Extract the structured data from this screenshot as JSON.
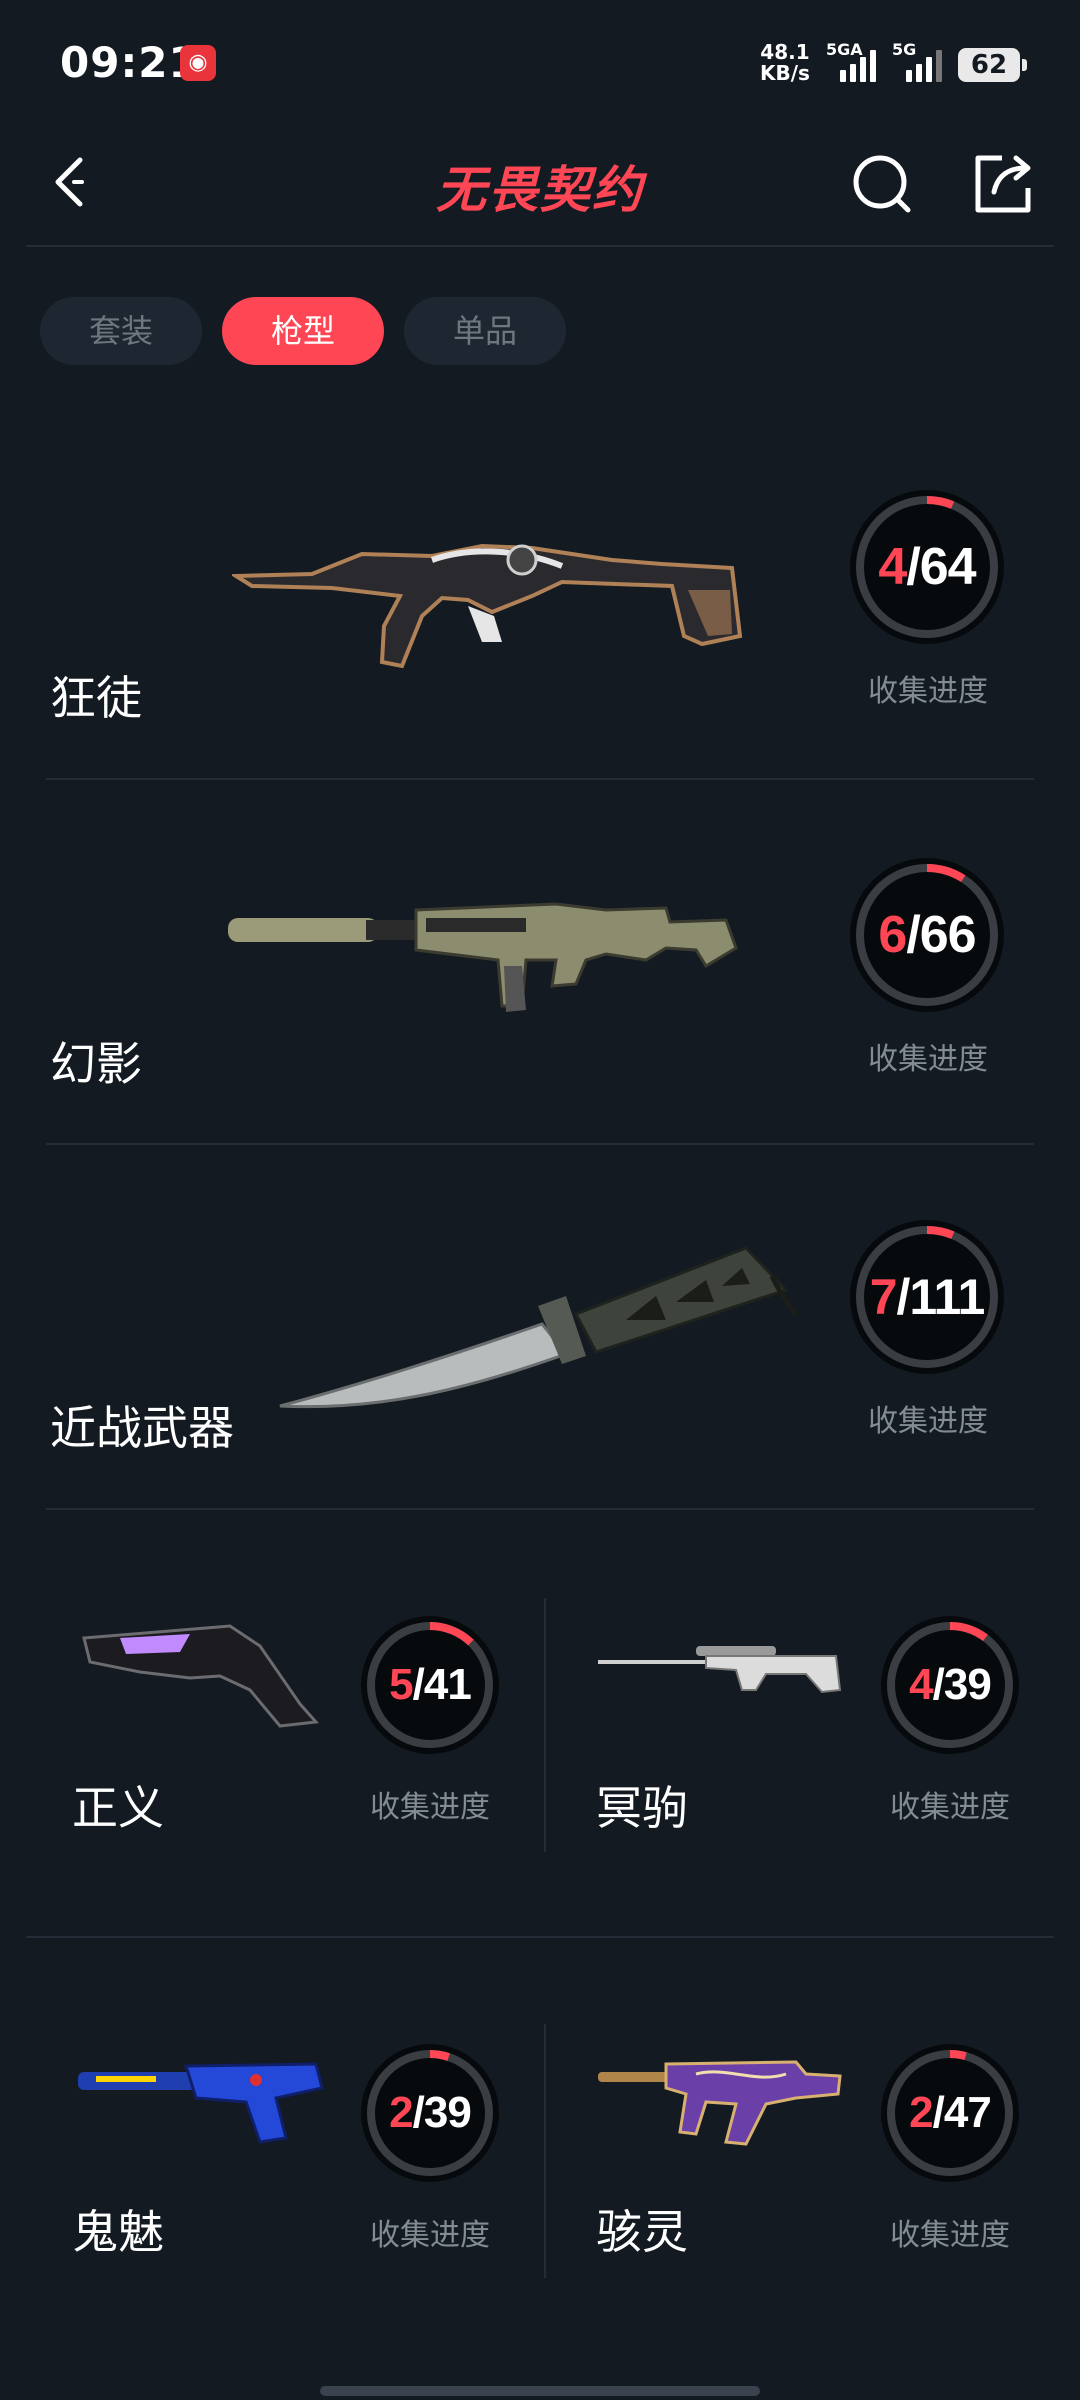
{
  "status_bar": {
    "time": "09:21",
    "speed_value": "48.1",
    "speed_unit": "KB/s",
    "net1": "5GA",
    "net2": "5G",
    "battery": "62"
  },
  "header": {
    "logo_text": "无畏契约"
  },
  "tabs": [
    {
      "label": "套装",
      "active": false
    },
    {
      "label": "枪型",
      "active": true
    },
    {
      "label": "单品",
      "active": false
    }
  ],
  "progress_label": "收集进度",
  "weapons": [
    {
      "name": "狂徒",
      "collected": "4",
      "total": "64",
      "progress": 0.0625
    },
    {
      "name": "幻影",
      "collected": "6",
      "total": "66",
      "progress": 0.0909
    },
    {
      "name": "近战武器",
      "collected": "7",
      "total": "111",
      "progress": 0.0631
    },
    {
      "name": "正义",
      "collected": "5",
      "total": "41",
      "progress": 0.122
    },
    {
      "name": "冥驹",
      "collected": "4",
      "total": "39",
      "progress": 0.1026
    },
    {
      "name": "鬼魅",
      "collected": "2",
      "total": "39",
      "progress": 0.0513
    },
    {
      "name": "骇灵",
      "collected": "2",
      "total": "47",
      "progress": 0.0426
    }
  ],
  "colors": {
    "accent": "#ff4655",
    "background": "#131a22",
    "tab_inactive": "#1e2731",
    "muted_text": "#838b93"
  }
}
